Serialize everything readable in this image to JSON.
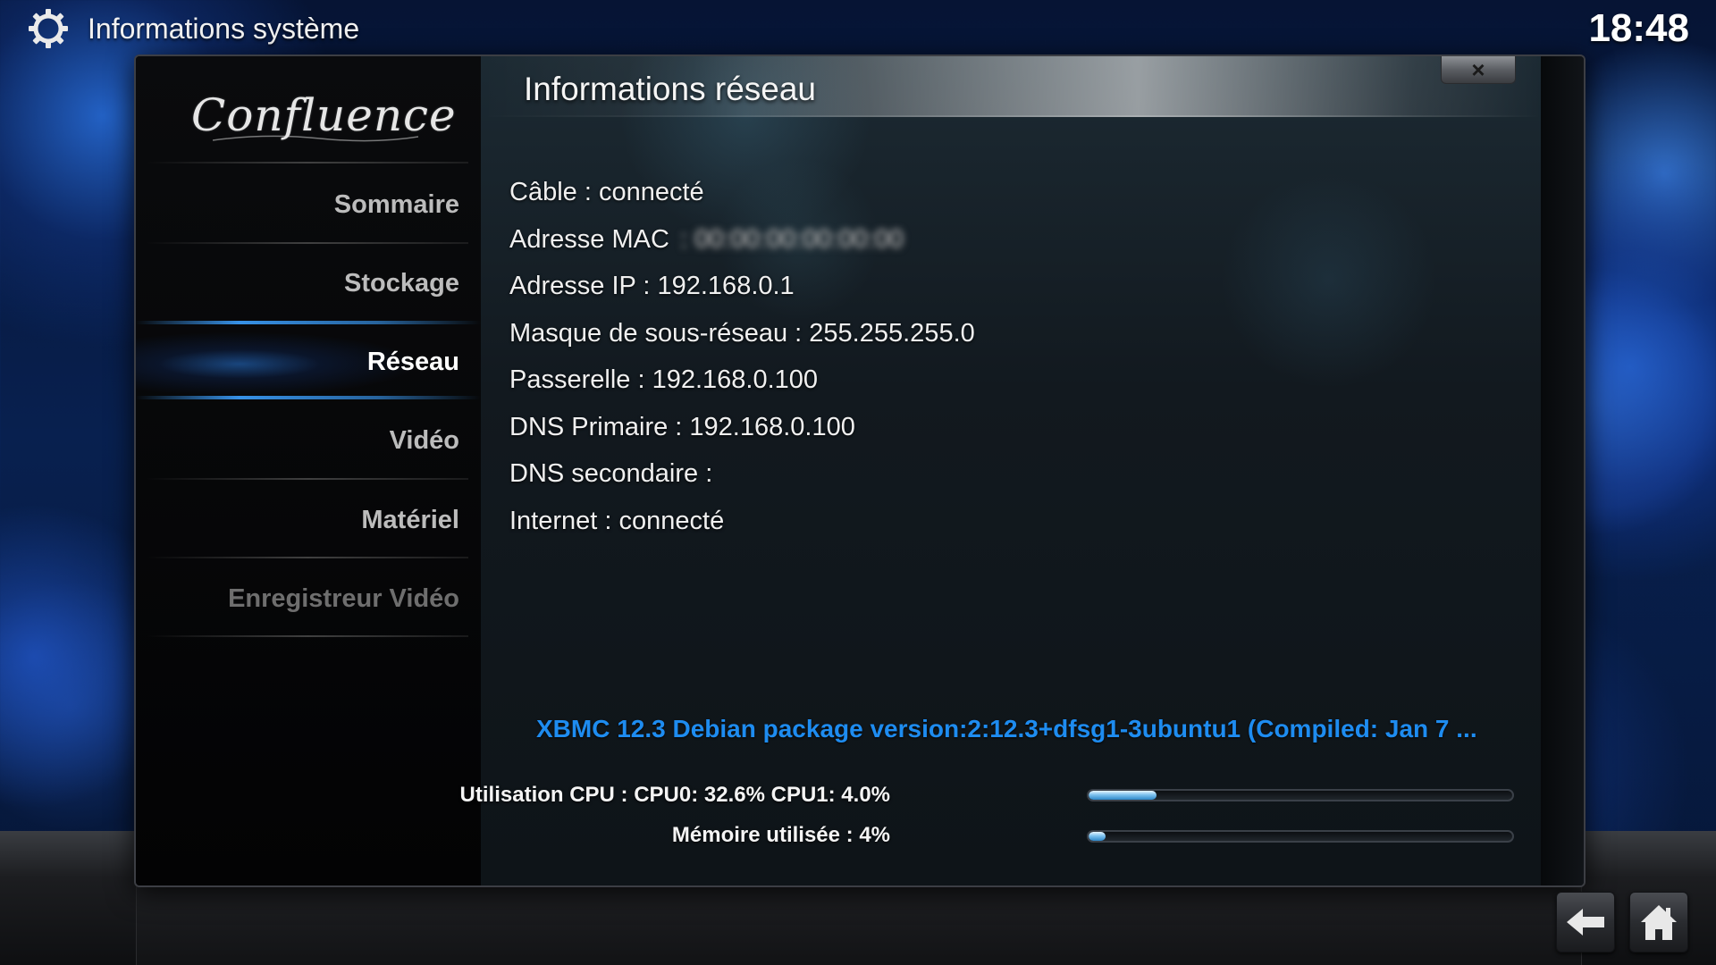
{
  "header": {
    "title": "Informations système",
    "clock": "18:48",
    "icon": "gear-icon"
  },
  "dialog": {
    "title": "Informations réseau",
    "close_label": "×",
    "logo_text": "Confluence"
  },
  "sidebar": {
    "items": [
      {
        "label": "Sommaire",
        "state": "normal"
      },
      {
        "label": "Stockage",
        "state": "normal"
      },
      {
        "label": "Réseau",
        "state": "active"
      },
      {
        "label": "Vidéo",
        "state": "normal"
      },
      {
        "label": "Matériel",
        "state": "normal"
      },
      {
        "label": "Enregistreur Vidéo",
        "state": "disabled"
      }
    ]
  },
  "network": {
    "cable": "Câble : connecté",
    "mac_label": "Adresse MAC",
    "mac_value": ": 00:00:00:00:00:00",
    "ip": "Adresse IP : 192.168.0.1",
    "netmask": "Masque de sous-réseau : 255.255.255.0",
    "gateway": "Passerelle : 192.168.0.100",
    "dns_primary": "DNS Primaire : 192.168.0.100",
    "dns_secondary": "DNS secondaire :",
    "internet": "Internet : connecté"
  },
  "footer": {
    "version": "XBMC 12.3 Debian package version:2:12.3+dfsg1-3ubuntu1 (Compiled: Jan  7 ...",
    "cpu_label": "Utilisation CPU : CPU0: 32.6% CPU1: 4.0%",
    "cpu_fraction": 0.16,
    "memory_label": "Mémoire utilisée : 4%",
    "memory_fraction": 0.04
  },
  "nav": {
    "back_icon": "back-arrow-icon",
    "home_icon": "home-icon"
  },
  "colors": {
    "accent_blue": "#1e8cf0",
    "background": "#08204f"
  }
}
